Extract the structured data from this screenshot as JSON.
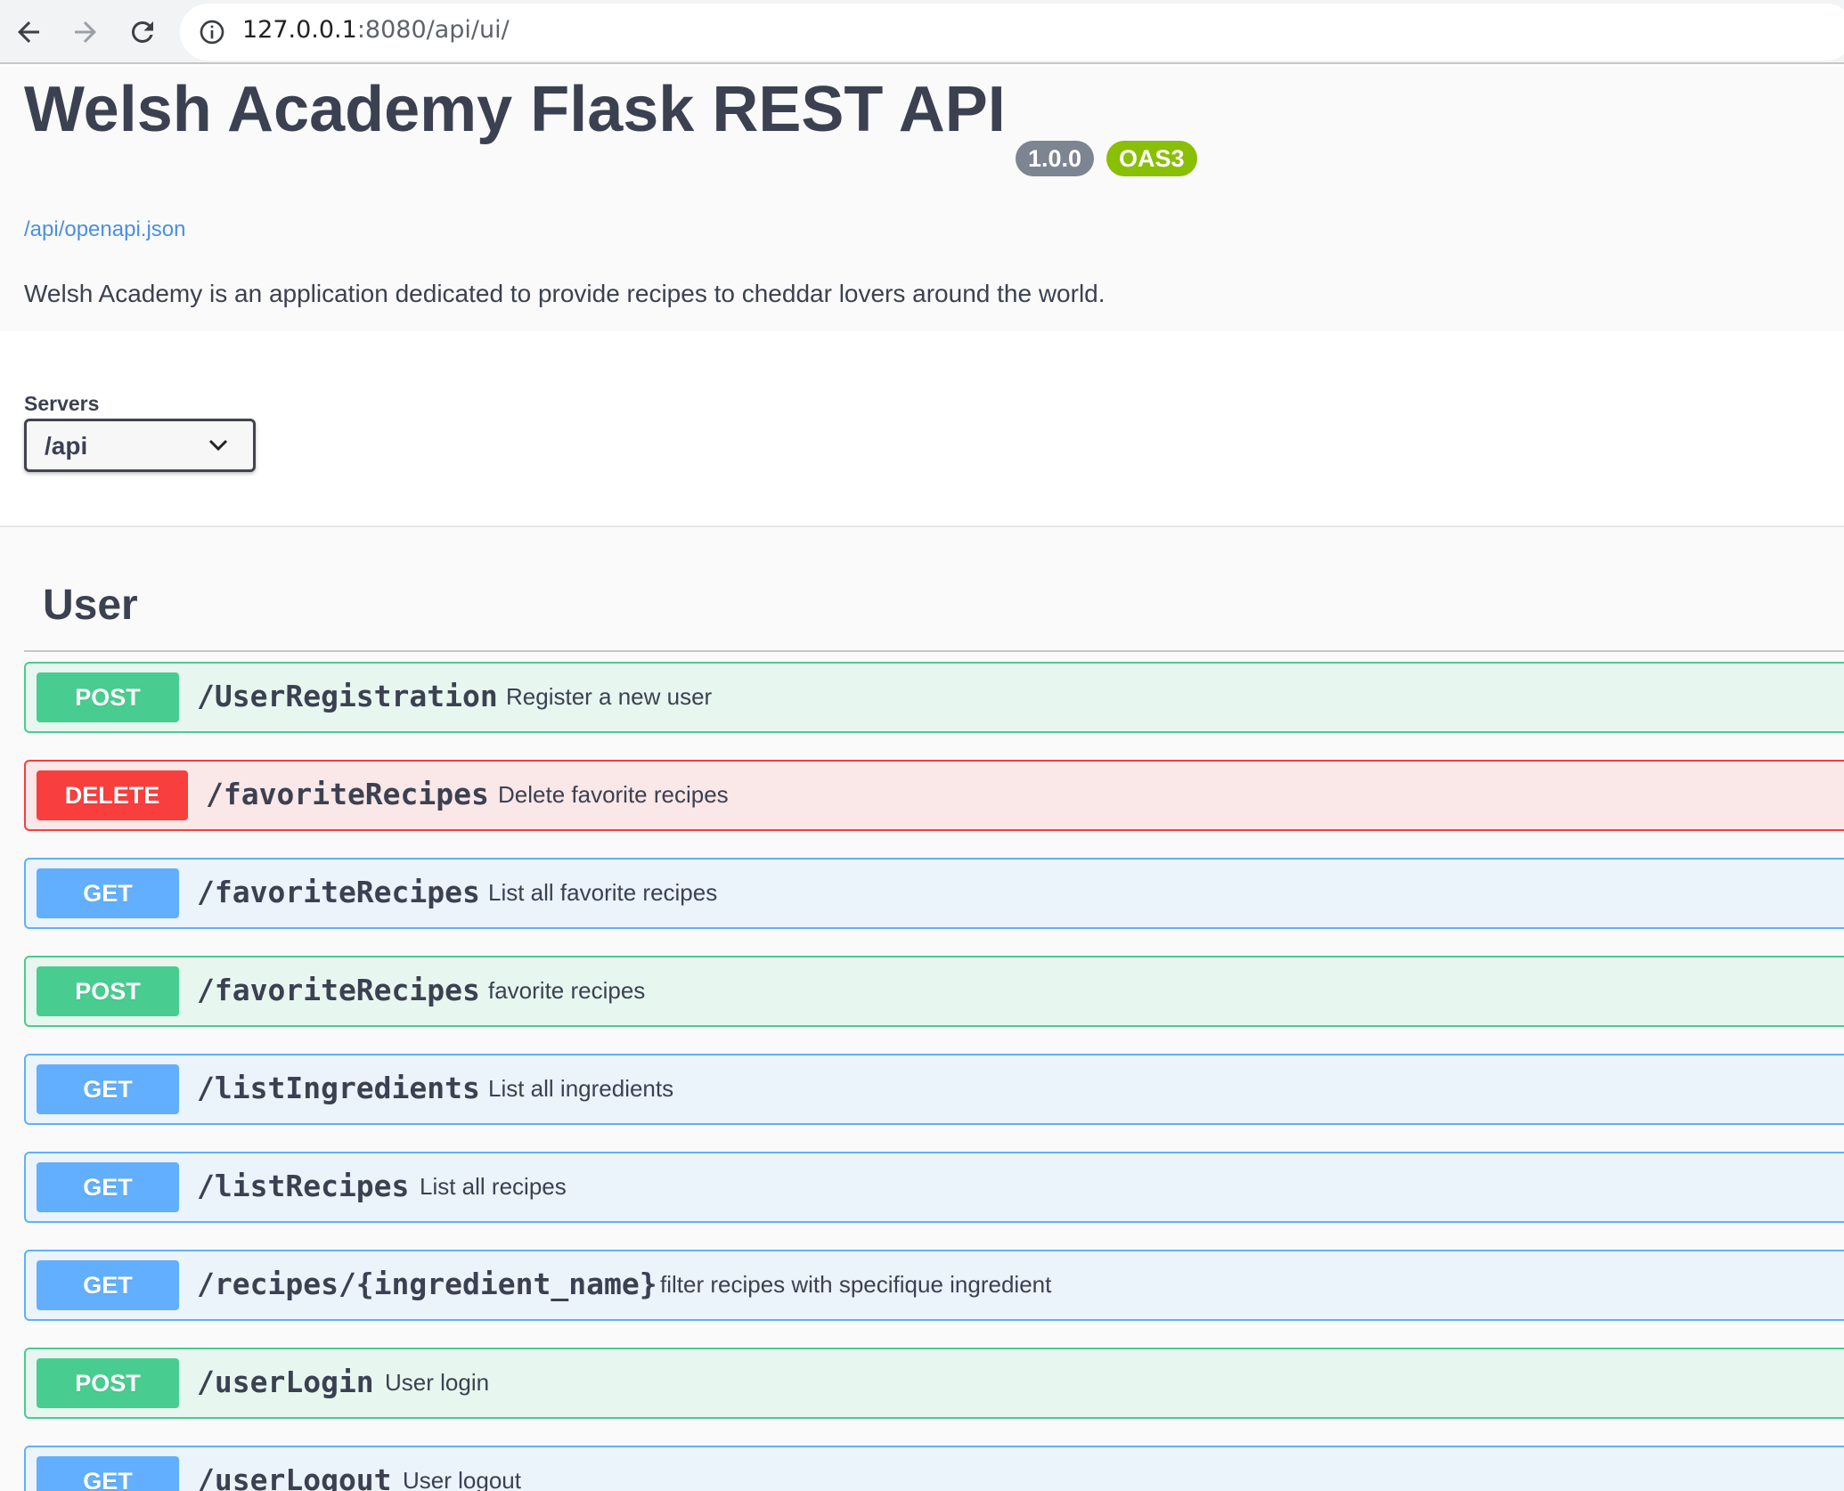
{
  "browser": {
    "url_host": "127.0.0.1",
    "url_rest": ":8080/api/ui/"
  },
  "info": {
    "title": "Welsh Academy Flask REST API",
    "version": "1.0.0",
    "oas": "OAS3",
    "spec_link": "/api/openapi.json",
    "description": "Welsh Academy is an application dedicated to provide recipes to cheddar lovers around the world."
  },
  "servers": {
    "label": "Servers",
    "selected": "/api"
  },
  "tag": {
    "name": "User"
  },
  "operations": [
    {
      "method": "POST",
      "path": "/UserRegistration",
      "summary": "Register a new user"
    },
    {
      "method": "DELETE",
      "path": "/favoriteRecipes",
      "summary": "Delete favorite recipes"
    },
    {
      "method": "GET",
      "path": "/favoriteRecipes",
      "summary": "List all favorite recipes"
    },
    {
      "method": "POST",
      "path": "/favoriteRecipes",
      "summary": "favorite recipes"
    },
    {
      "method": "GET",
      "path": "/listIngredients",
      "summary": "List all ingredients"
    },
    {
      "method": "GET",
      "path": "/listRecipes",
      "summary": "List all recipes"
    },
    {
      "method": "GET",
      "path": "/recipes/{ingredient_name}",
      "summary": "filter recipes with specifique ingredient"
    },
    {
      "method": "POST",
      "path": "/userLogin",
      "summary": "User login"
    },
    {
      "method": "GET",
      "path": "/userLogout",
      "summary": "User logout"
    }
  ],
  "colors": {
    "post": "#49cc90",
    "delete": "#f93e3e",
    "get": "#61affe",
    "version_badge": "#7d8492",
    "oas_badge": "#89bf04",
    "link": "#4990e2"
  }
}
